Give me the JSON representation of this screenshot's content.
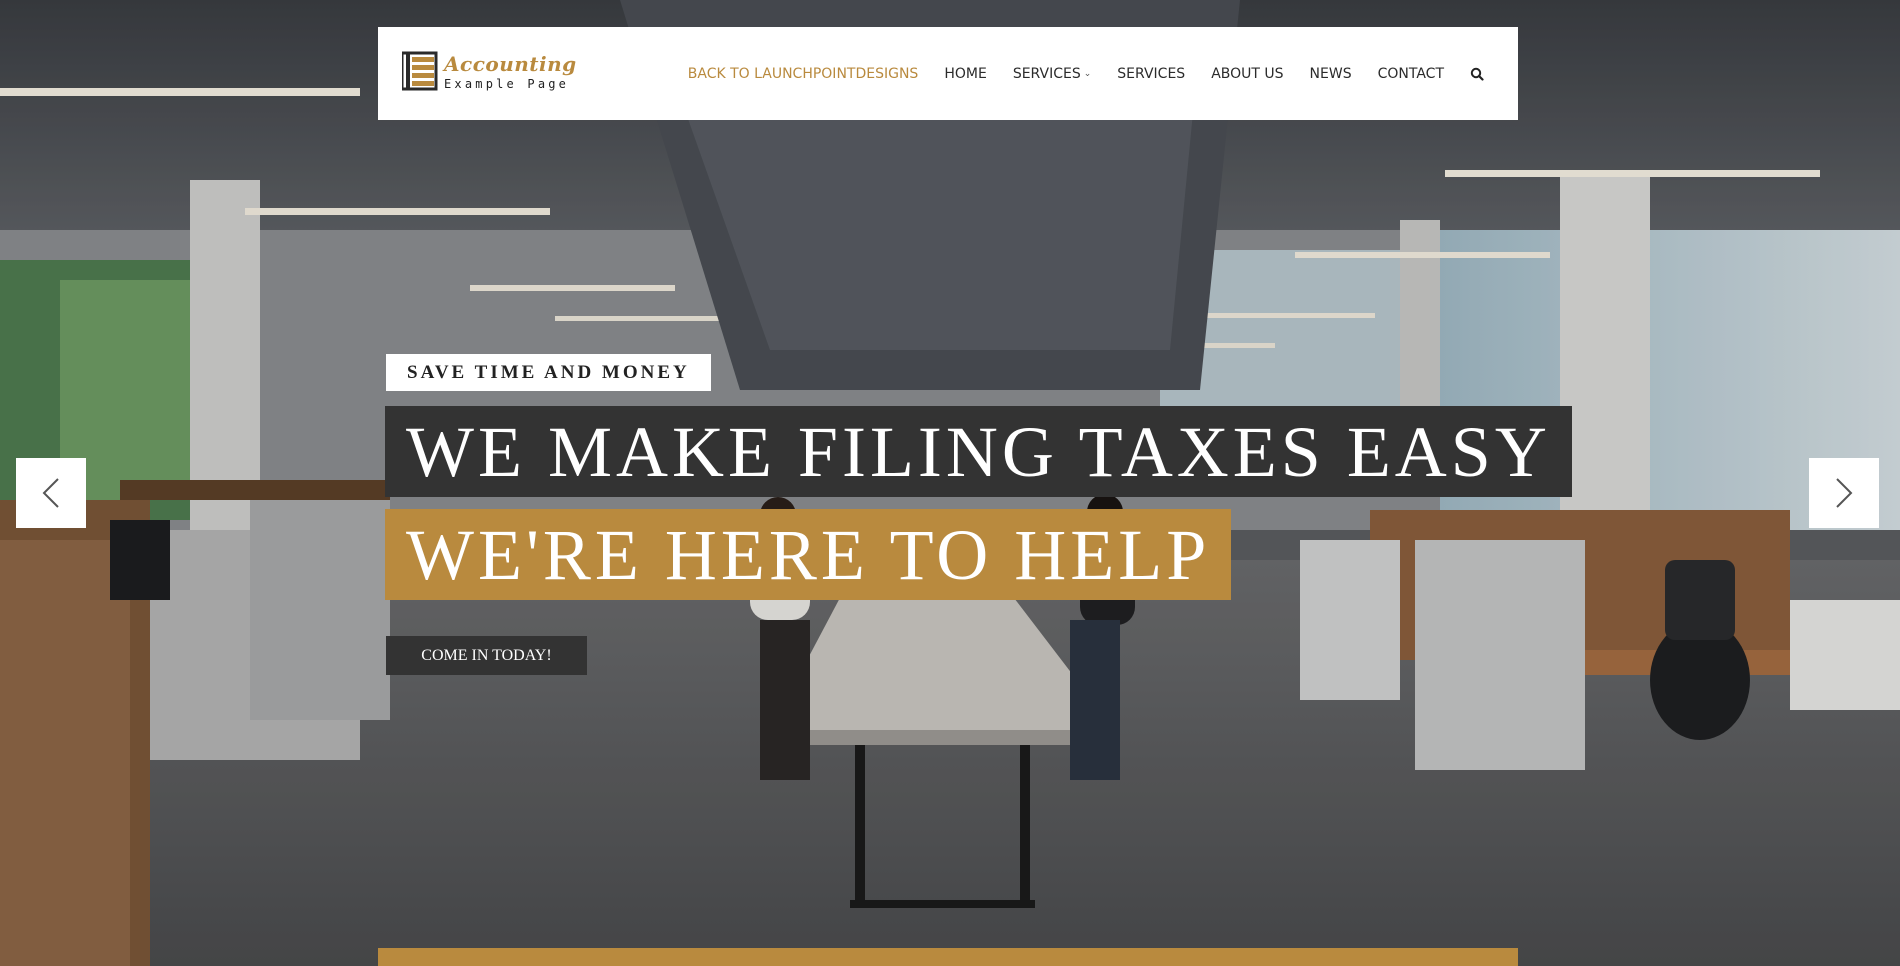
{
  "logo": {
    "title": "Accounting",
    "subtitle": "Example Page",
    "icon": "ledger-logo-icon",
    "accent_color": "#b98a3e"
  },
  "nav": {
    "items": [
      {
        "label": "BACK TO LAUNCHPOINTDESIGNS",
        "active": true
      },
      {
        "label": "HOME"
      },
      {
        "label": "SERVICES",
        "has_dropdown": true
      },
      {
        "label": "SERVICES"
      },
      {
        "label": "ABOUT US"
      },
      {
        "label": "NEWS"
      },
      {
        "label": "CONTACT"
      }
    ],
    "search_icon": "search-icon"
  },
  "hero": {
    "kicker": "SAVE TIME AND MONEY",
    "headline_1": "WE MAKE FILING TAXES EASY",
    "headline_2": "WE'RE HERE TO HELP",
    "cta_label": "COME IN TODAY!",
    "prev_icon": "chevron-left-icon",
    "next_icon": "chevron-right-icon",
    "background": "open-plan-office-photo"
  },
  "colors": {
    "gold": "#b98a3e",
    "dark": "#333333",
    "white": "#ffffff"
  }
}
